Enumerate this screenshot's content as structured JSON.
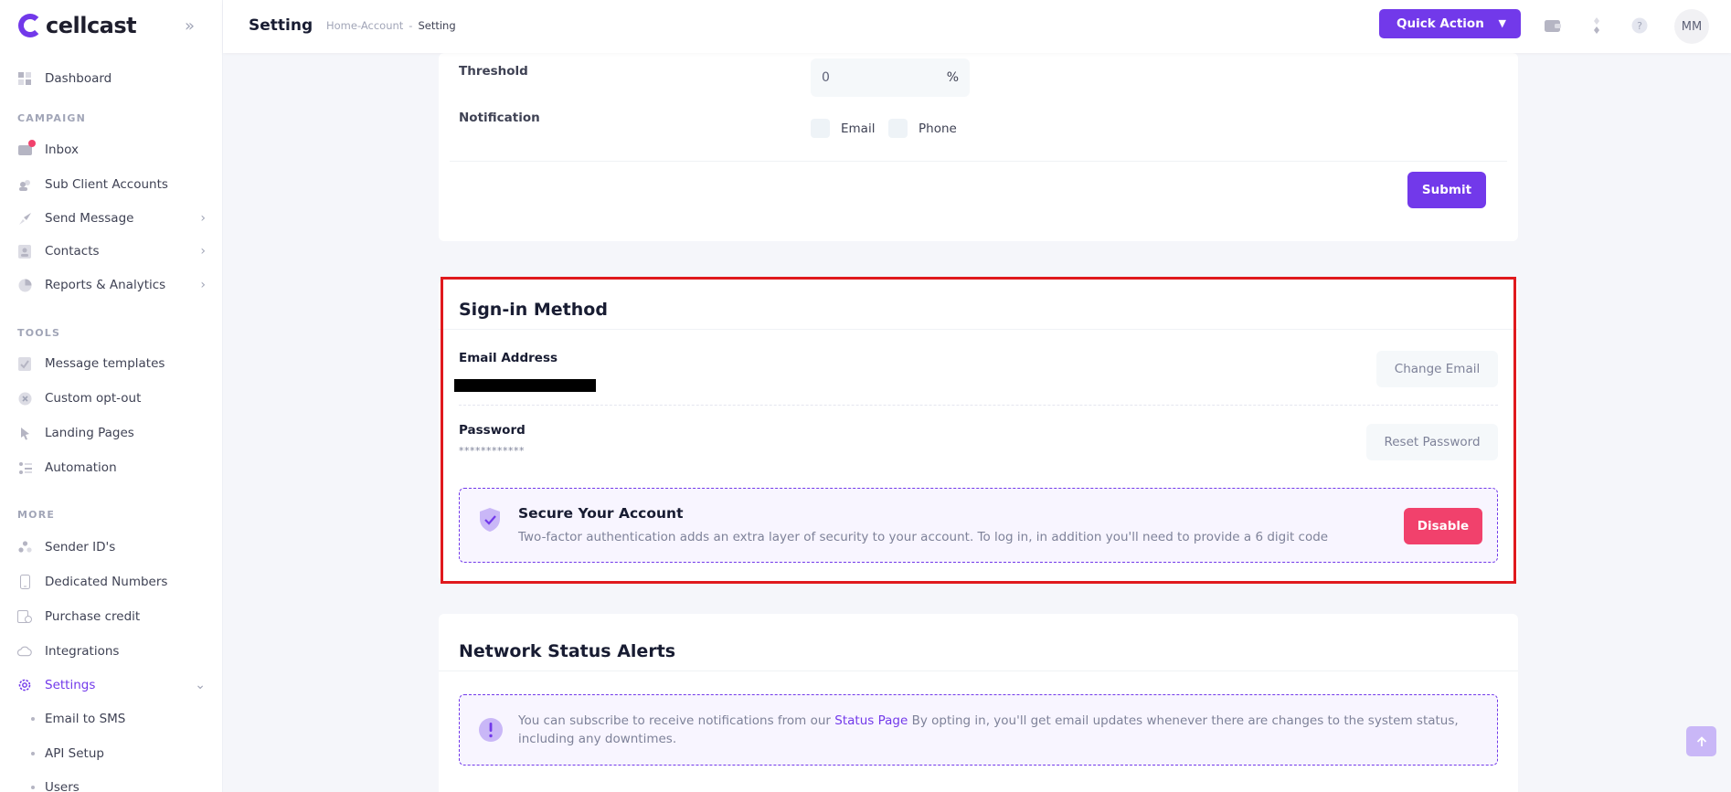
{
  "brand": {
    "name": "cellcast",
    "accent": "#7239ea",
    "danger": "#f1416c"
  },
  "sidebar": {
    "dashboard": "Dashboard",
    "section_campaign": "CAMPAIGN",
    "inbox": "Inbox",
    "sub_client_accounts": "Sub Client Accounts",
    "send_message": "Send Message",
    "contacts": "Contacts",
    "reports": "Reports & Analytics",
    "section_tools": "TOOLS",
    "message_templates": "Message templates",
    "custom_opt_out": "Custom opt-out",
    "landing_pages": "Landing Pages",
    "automation": "Automation",
    "section_more": "MORE",
    "sender_ids": "Sender ID's",
    "dedicated_numbers": "Dedicated Numbers",
    "purchase_credit": "Purchase credit",
    "integrations": "Integrations",
    "settings": "Settings",
    "email_to_sms": "Email to SMS",
    "api_setup": "API Setup",
    "users": "Users"
  },
  "header": {
    "title": "Setting",
    "breadcrumb_home": "Home-Account",
    "breadcrumb_sep": "-",
    "breadcrumb_current": "Setting",
    "quick_action": "Quick Action",
    "avatar_initials": "MM"
  },
  "alerts_form": {
    "threshold_label": "Threshold",
    "threshold_value": "0",
    "threshold_unit": "%",
    "notification_label": "Notification",
    "email_option": "Email",
    "phone_option": "Phone",
    "submit": "Submit"
  },
  "signin": {
    "title": "Sign-in Method",
    "email_label": "Email Address",
    "change_email": "Change Email",
    "password_label": "Password",
    "password_mask": "************",
    "reset_password": "Reset Password",
    "secure_title": "Secure Your Account",
    "secure_text": "Two-factor authentication adds an extra layer of security to your account. To log in, in addition you'll need to provide a 6 digit code",
    "disable": "Disable"
  },
  "network": {
    "title": "Network Status Alerts",
    "text_before": "You can subscribe to receive notifications from our",
    "link": "Status Page",
    "text_after": "By opting in, you'll get email updates whenever there are changes to the system status,",
    "text_line2": "including any downtimes."
  }
}
